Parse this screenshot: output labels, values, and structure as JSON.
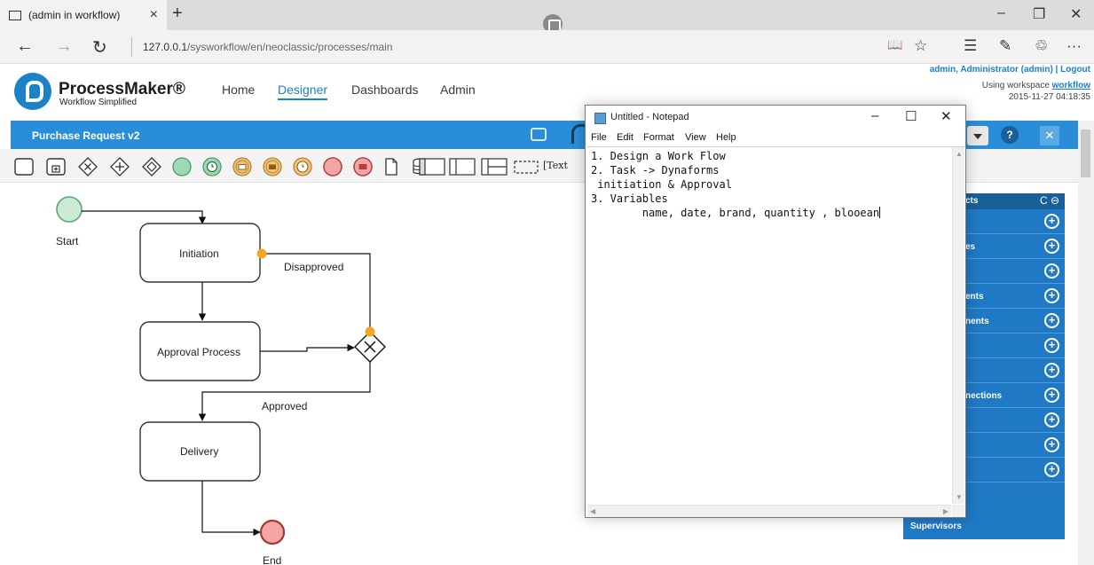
{
  "browser": {
    "tab_title": "(admin in workflow)",
    "tab_close": "×",
    "new_tab": "+",
    "win_min": "–",
    "win_restore": "❐",
    "win_close": "✕",
    "back": "←",
    "forward": "→",
    "refresh": "↻",
    "url_host": "127.0.0.1",
    "url_path": "/sysworkflow/en/neoclassic/processes/main",
    "reading_view": "📖",
    "favorite": "☆",
    "hub": "☰",
    "notes": "✎",
    "share": "♲",
    "more": "···"
  },
  "header": {
    "brand": "ProcessMaker®",
    "tagline": "Workflow Simplified",
    "nav": [
      "Home",
      "Designer",
      "Dashboards",
      "Admin"
    ],
    "user_info": "admin, Administrator (admin) | Logout",
    "workspace_prefix": "Using workspace ",
    "workspace_name": "workflow",
    "datetime": "2015-11-27 04:18:35"
  },
  "designer": {
    "process_title": "Purchase Request v2",
    "help_label": "?",
    "close_label": "✕"
  },
  "toolbar": {
    "text_tool": "[Text"
  },
  "diagram": {
    "start_label": "Start",
    "tasks": [
      "Initiation",
      "Approval Process",
      "Delivery"
    ],
    "end_label": "End",
    "flow_labels": {
      "disapproved": "Disapproved",
      "approved": "Approved"
    }
  },
  "side_panel": {
    "header": "cts",
    "header_tools": "C ⊖",
    "items": [
      "",
      "es",
      "",
      "ents",
      "nents",
      "",
      "",
      "nections",
      "",
      "",
      ""
    ],
    "plus": "+",
    "bottom": "Supervisors"
  },
  "notepad": {
    "title": "Untitled - Notepad",
    "ctl_min": "–",
    "ctl_max": "☐",
    "ctl_close": "✕",
    "menu": [
      "File",
      "Edit",
      "Format",
      "View",
      "Help"
    ],
    "lines": [
      "1. Design a Work Flow",
      "2. Task -> Dynaforms",
      " initiation & Approval",
      "3. Variables",
      "        name, date, brand, quantity , blooean"
    ]
  },
  "colors": {
    "accent": "#2a8dd8",
    "panel": "#1f79c4",
    "start_event": "#c9ead3",
    "end_event": "#f4a6a6",
    "connector_dot": "#f5a623"
  }
}
